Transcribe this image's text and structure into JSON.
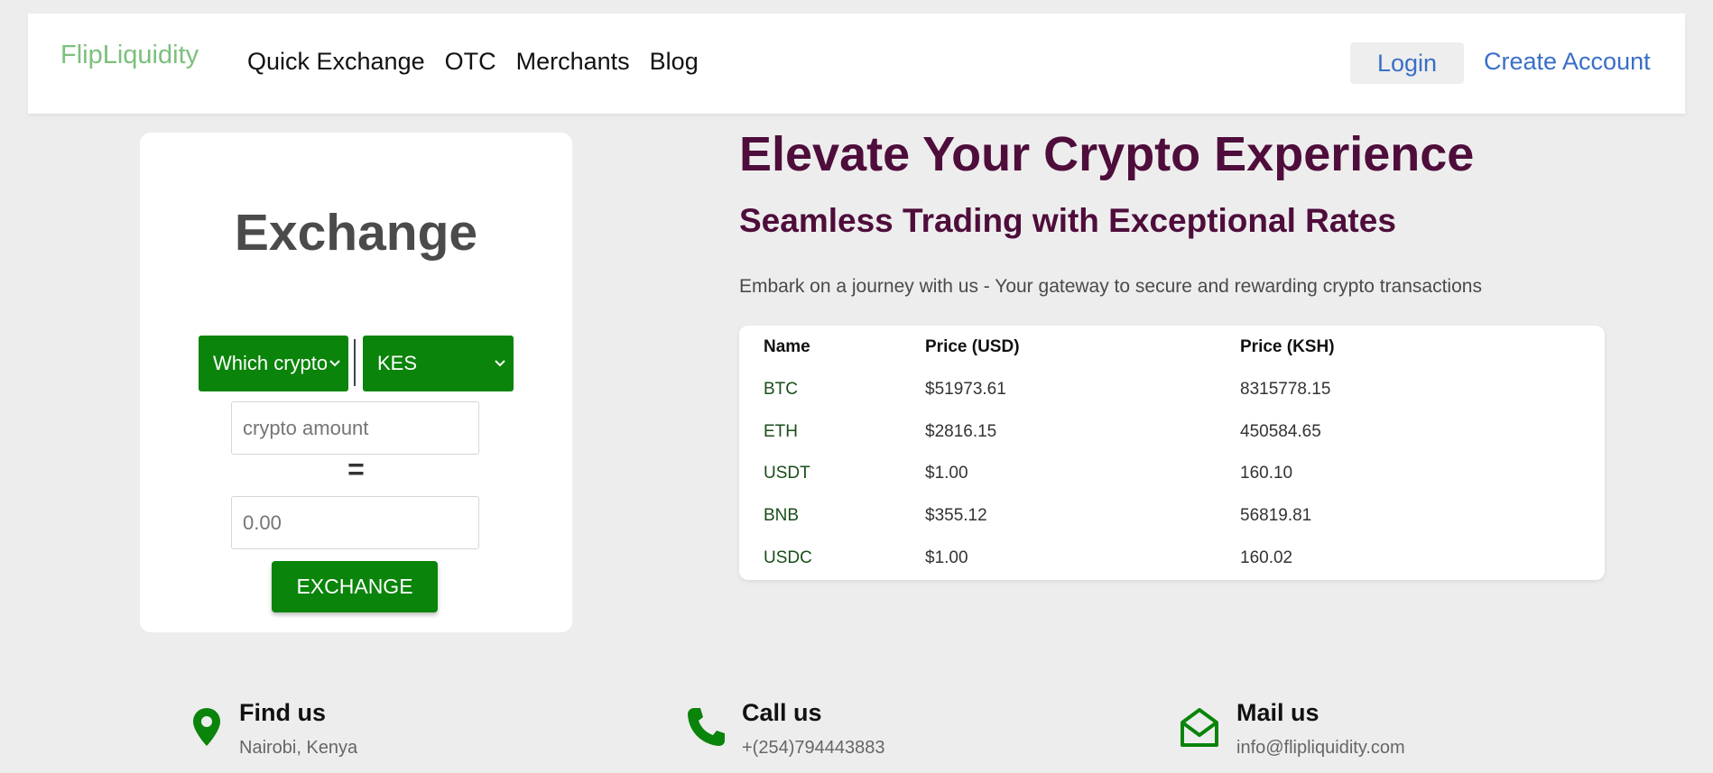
{
  "header": {
    "brand": "FlipLiquidity",
    "nav": [
      "Quick Exchange",
      "OTC",
      "Merchants",
      "Blog"
    ],
    "login_label": "Login",
    "create_account_label": "Create Account"
  },
  "exchange": {
    "title": "Exchange",
    "crypto_select_value": "Which crypto",
    "fiat_select_value": "KES",
    "crypto_amount_placeholder": "crypto amount",
    "equals": "=",
    "result_placeholder": "0.00",
    "button_label": "EXCHANGE"
  },
  "hero": {
    "title": "Elevate Your Crypto Experience",
    "subtitle": "Seamless Trading with Exceptional Rates",
    "description": "Embark on a journey with us - Your gateway to secure and rewarding crypto transactions"
  },
  "prices": {
    "headers": [
      "Name",
      "Price (USD)",
      "Price (KSH)"
    ],
    "rows": [
      {
        "name": "BTC",
        "usd": "$51973.61",
        "ksh": "8315778.15"
      },
      {
        "name": "ETH",
        "usd": "$2816.15",
        "ksh": "450584.65"
      },
      {
        "name": "USDT",
        "usd": "$1.00",
        "ksh": "160.10"
      },
      {
        "name": "BNB",
        "usd": "$355.12",
        "ksh": "56819.81"
      },
      {
        "name": "USDC",
        "usd": "$1.00",
        "ksh": "160.02"
      }
    ]
  },
  "contacts": [
    {
      "icon": "location-pin-icon",
      "title": "Find us",
      "value": "Nairobi, Kenya"
    },
    {
      "icon": "phone-icon",
      "title": "Call us",
      "value": "+(254)794443883"
    },
    {
      "icon": "envelope-open-icon",
      "title": "Mail us",
      "value": "info@flipliquidity.com"
    }
  ],
  "colors": {
    "accent_green": "#0a840a",
    "brand_green": "#7dbf7d",
    "hero_purple": "#4e0d3b",
    "link_blue": "#3a6fc7",
    "page_bg": "#ededed"
  }
}
